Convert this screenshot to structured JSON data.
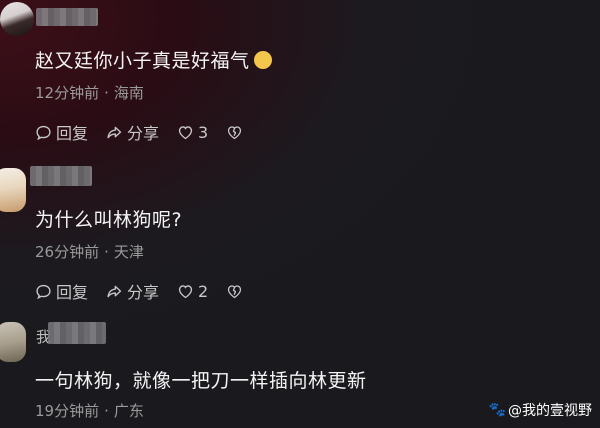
{
  "comments": [
    {
      "text": "赵又廷你小子真是好福气",
      "time": "12分钟前",
      "location": "海南",
      "reply_label": "回复",
      "share_label": "分享",
      "like_count": "3"
    },
    {
      "text": "为什么叫林狗呢?",
      "time": "26分钟前",
      "location": "天津",
      "reply_label": "回复",
      "share_label": "分享",
      "like_count": "2"
    },
    {
      "username_visible": "我",
      "text": "一句林狗，就像一把刀一样插向林更新",
      "time": "19分钟前",
      "location": "广东"
    }
  ],
  "separator": "·",
  "watermark": "@我的壹视野",
  "colors": {
    "bg_red": "#3d0f18",
    "bg_dark": "#1a1a1e",
    "text": "#f4f4f4",
    "meta": "#9a9a9a"
  }
}
